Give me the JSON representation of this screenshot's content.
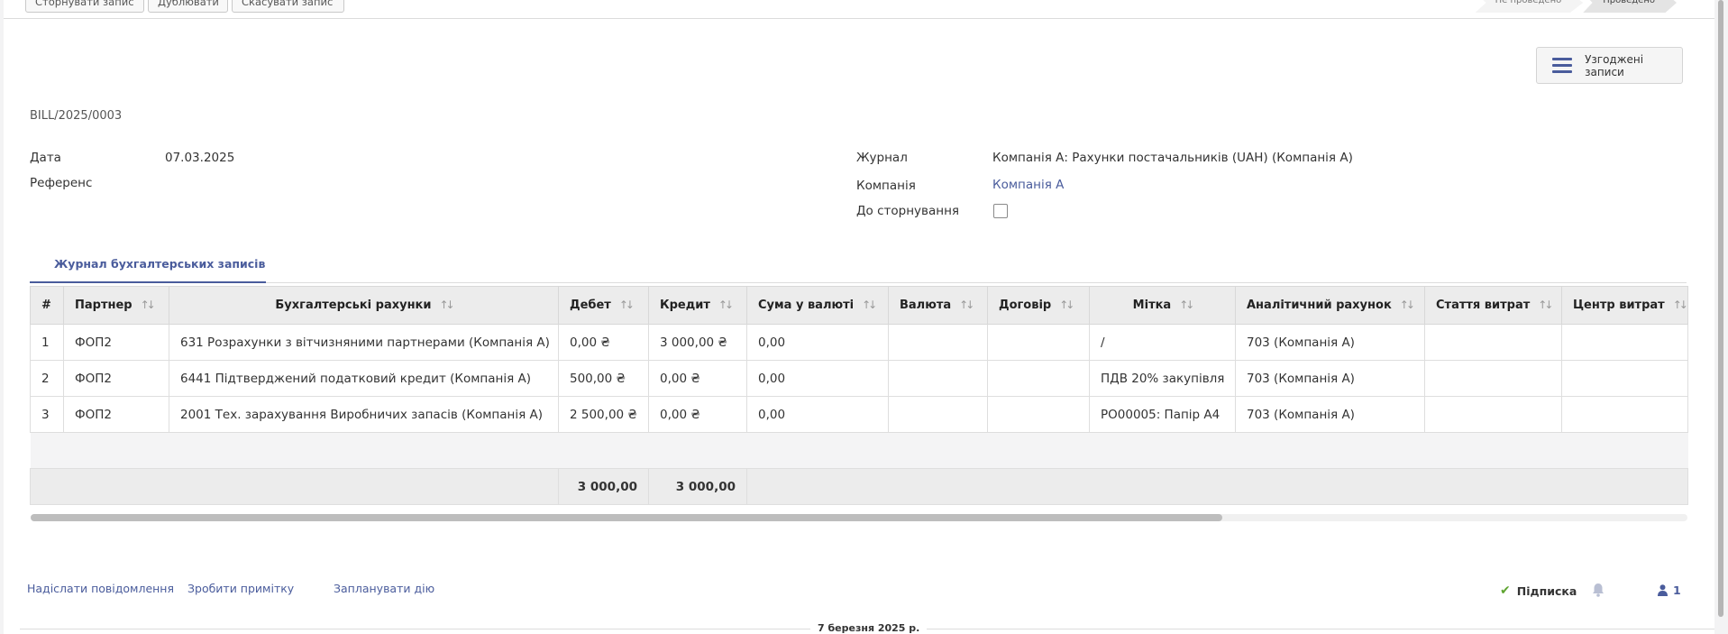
{
  "toolbar": {
    "reverse_label": "Сторнувати запис",
    "duplicate_label": "Дублювати",
    "cancel_label": "Скасувати запис"
  },
  "status": {
    "draft": "Не проведено",
    "posted": "Проведено"
  },
  "reconciled_button": "Узгоджені записи",
  "doc_name": "BILL/2025/0003",
  "fields": {
    "date_label": "Дата",
    "date_value": "07.03.2025",
    "ref_label": "Референс",
    "journal_label": "Журнал",
    "journal_value": "Компанія А: Рахунки постачальників (UAH) (Компанія А)",
    "company_label": "Компанія",
    "company_value": "Компанія А",
    "to_reverse_label": "До сторнування"
  },
  "tab_label": "Журнал бухгалтерських записів",
  "table": {
    "headers": [
      "#",
      "Партнер",
      "Бухгалтерські рахунки",
      "Дебет",
      "Кредит",
      "Сума у валюті",
      "Валюта",
      "Договір",
      "Мітка",
      "Аналітичний рахунок",
      "Стаття витрат",
      "Центр витрат"
    ],
    "rows": [
      [
        "1",
        "ФОП2",
        "631 Розрахунки з вітчизняними партнерами (Компанія А)",
        "0,00 ₴",
        "3 000,00 ₴",
        "0,00",
        "",
        "",
        "/",
        "703 (Компанія А)",
        "",
        ""
      ],
      [
        "2",
        "ФОП2",
        "6441 Підтверджений податковий кредит (Компанія А)",
        "500,00 ₴",
        "0,00 ₴",
        "0,00",
        "",
        "",
        "ПДВ 20% закупівля",
        "703 (Компанія А)",
        "",
        ""
      ],
      [
        "3",
        "ФОП2",
        "2001 Тех. зарахування Виробничих запасів (Компанія А)",
        "2 500,00 ₴",
        "0,00 ₴",
        "0,00",
        "",
        "",
        "PO00005: Папір А4",
        "703 (Компанія А)",
        "",
        ""
      ]
    ],
    "total_debit": "3 000,00",
    "total_credit": "3 000,00"
  },
  "chatter": {
    "send_message": "Надіслати повідомлення",
    "log_note": "Зробити примітку",
    "schedule_activity": "Запланувати дію",
    "follow_label": "Підписка",
    "followers_count": "1",
    "date_separator": "7 березня 2025 р."
  },
  "colors": {
    "accent": "#4a5c9c",
    "follow_check": "#5fa531"
  }
}
